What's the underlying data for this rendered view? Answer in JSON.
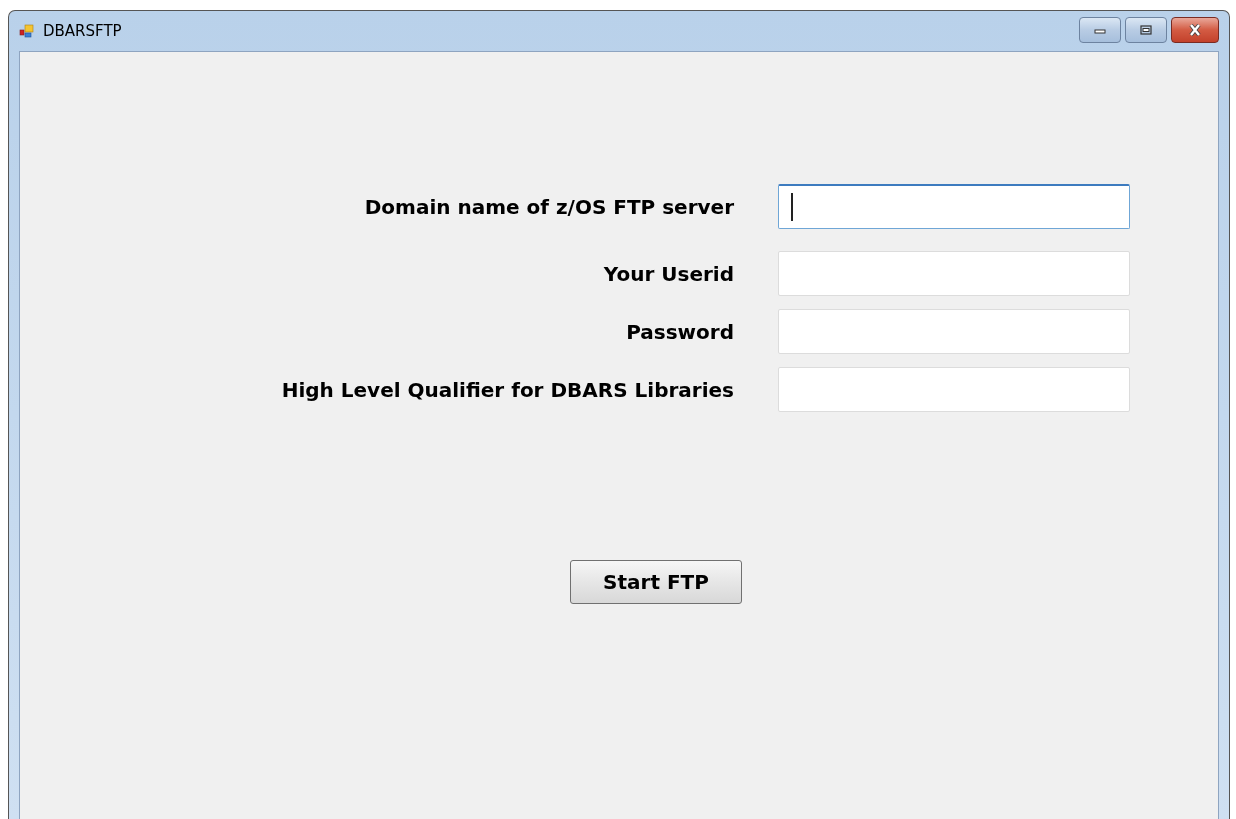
{
  "window": {
    "title": "DBARSFTP"
  },
  "fields": [
    {
      "label": "Domain name of z/OS FTP server",
      "focused": true
    },
    {
      "label": "Your Userid",
      "focused": false
    },
    {
      "label": "Password",
      "focused": false
    },
    {
      "label": "High Level Qualifier for DBARS Libraries",
      "focused": false
    }
  ],
  "button": {
    "label": "Start FTP"
  }
}
